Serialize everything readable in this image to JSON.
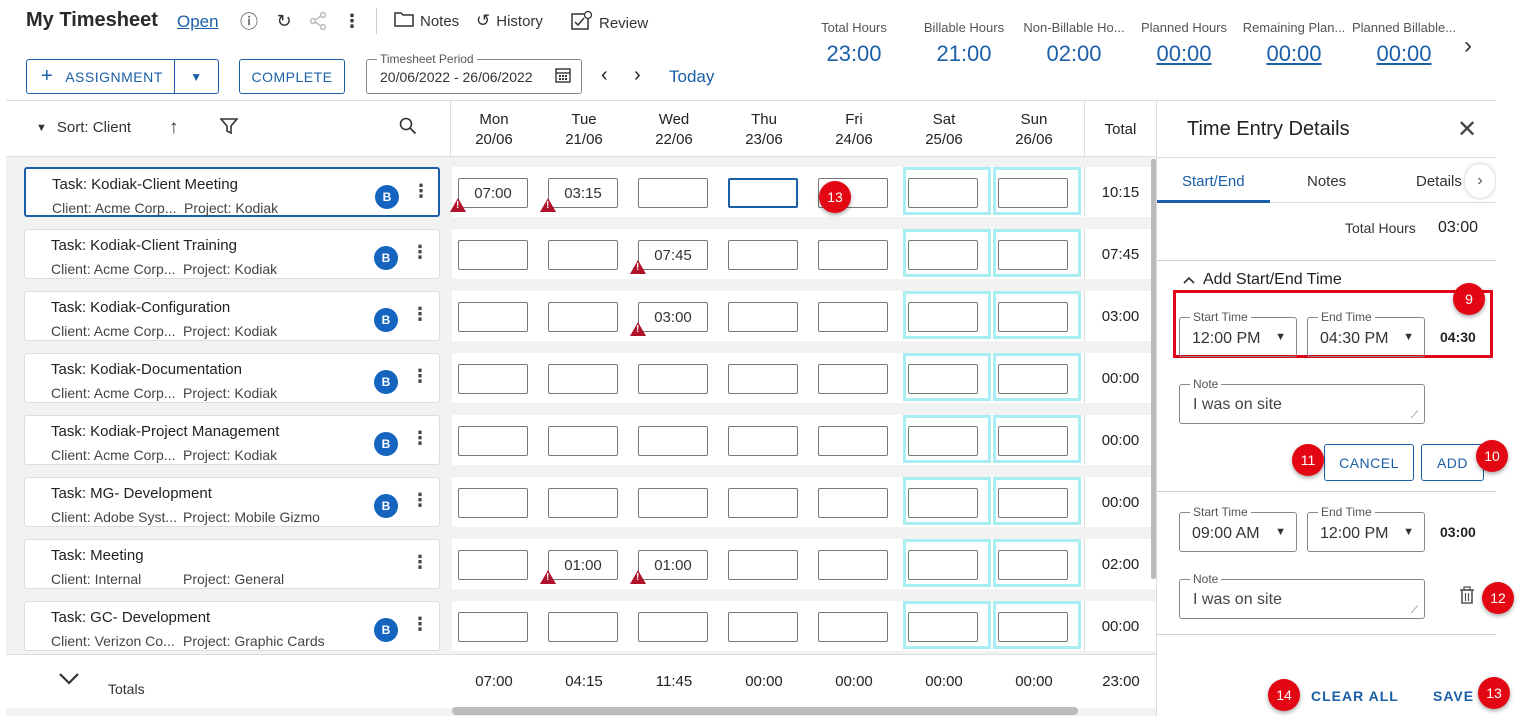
{
  "header": {
    "title": "My Timesheet",
    "status": "Open",
    "tools": {
      "notes": "Notes",
      "history": "History",
      "review": "Review"
    },
    "assignment_label": "ASSIGNMENT",
    "complete_label": "COMPLETE",
    "period_label": "Timesheet Period",
    "period_value": "20/06/2022 - 26/06/2022",
    "today": "Today"
  },
  "summary": [
    {
      "label": "Total Hours",
      "value": "23:00"
    },
    {
      "label": "Billable Hours",
      "value": "21:00"
    },
    {
      "label": "Non-Billable Ho...",
      "value": "02:00"
    },
    {
      "label": "Planned Hours",
      "value": "00:00"
    },
    {
      "label": "Remaining Plan...",
      "value": "00:00"
    },
    {
      "label": "Planned Billable...",
      "value": "00:00"
    }
  ],
  "grid": {
    "sort_label": "Sort: Client",
    "total_header": "Total",
    "totals_label": "Totals",
    "days": [
      {
        "name": "Mon",
        "date": "20/06"
      },
      {
        "name": "Tue",
        "date": "21/06"
      },
      {
        "name": "Wed",
        "date": "22/06"
      },
      {
        "name": "Thu",
        "date": "23/06"
      },
      {
        "name": "Fri",
        "date": "24/06"
      },
      {
        "name": "Sat",
        "date": "25/06"
      },
      {
        "name": "Sun",
        "date": "26/06"
      }
    ],
    "rows": [
      {
        "task": "Task: Kodiak-Client Meeting",
        "client": "Client: Acme Corp...",
        "project": "Project: Kodiak",
        "badge": "B",
        "total": "10:15",
        "cells": [
          "07:00",
          "03:15",
          "",
          "",
          "",
          "",
          ""
        ]
      },
      {
        "task": "Task: Kodiak-Client Training",
        "client": "Client: Acme Corp...",
        "project": "Project: Kodiak",
        "badge": "B",
        "total": "07:45",
        "cells": [
          "",
          "",
          "07:45",
          "",
          "",
          "",
          ""
        ]
      },
      {
        "task": "Task: Kodiak-Configuration",
        "client": "Client: Acme Corp...",
        "project": "Project: Kodiak",
        "badge": "B",
        "total": "03:00",
        "cells": [
          "",
          "",
          "03:00",
          "",
          "",
          "",
          ""
        ]
      },
      {
        "task": "Task: Kodiak-Documentation",
        "client": "Client: Acme Corp...",
        "project": "Project: Kodiak",
        "badge": "B",
        "total": "00:00",
        "cells": [
          "",
          "",
          "",
          "",
          "",
          "",
          ""
        ]
      },
      {
        "task": "Task: Kodiak-Project Management",
        "client": "Client: Acme Corp...",
        "project": "Project: Kodiak",
        "badge": "B",
        "total": "00:00",
        "cells": [
          "",
          "",
          "",
          "",
          "",
          "",
          ""
        ]
      },
      {
        "task": "Task: MG- Development",
        "client": "Client: Adobe Syst...",
        "project": "Project: Mobile Gizmo",
        "badge": "B",
        "total": "00:00",
        "cells": [
          "",
          "",
          "",
          "",
          "",
          "",
          ""
        ]
      },
      {
        "task": "Task: Meeting",
        "client": "Client: Internal",
        "project": "Project: General",
        "badge": "",
        "total": "02:00",
        "cells": [
          "",
          "01:00",
          "01:00",
          "",
          "",
          "",
          ""
        ]
      },
      {
        "task": "Task: GC- Development",
        "client": "Client: Verizon Co...",
        "project": "Project: Graphic Cards",
        "badge": "B",
        "total": "00:00",
        "cells": [
          "",
          "",
          "",
          "",
          "",
          "",
          ""
        ]
      }
    ],
    "day_totals": [
      "07:00",
      "04:15",
      "11:45",
      "00:00",
      "00:00",
      "00:00",
      "00:00"
    ],
    "grand_total": "23:00"
  },
  "panel": {
    "title": "Time Entry Details",
    "tabs": [
      "Start/End",
      "Notes",
      "Details"
    ],
    "total_hours_label": "Total Hours",
    "total_hours_value": "03:00",
    "add_heading": "Add Start/End Time",
    "new_entry": {
      "start_label": "Start Time",
      "start": "12:00 PM",
      "end_label": "End Time",
      "end": "04:30 PM",
      "duration": "04:30",
      "note_label": "Note",
      "note": "I was on site"
    },
    "cancel": "CANCEL",
    "add": "ADD",
    "entry": {
      "start_label": "Start Time",
      "start": "09:00 AM",
      "end_label": "End Time",
      "end": "12:00 PM",
      "duration": "03:00",
      "note_label": "Note",
      "note": "I was on site"
    },
    "clear_all": "CLEAR ALL",
    "save": "SAVE"
  },
  "callouts": [
    "13",
    "9",
    "11",
    "10",
    "12",
    "14",
    "13"
  ]
}
